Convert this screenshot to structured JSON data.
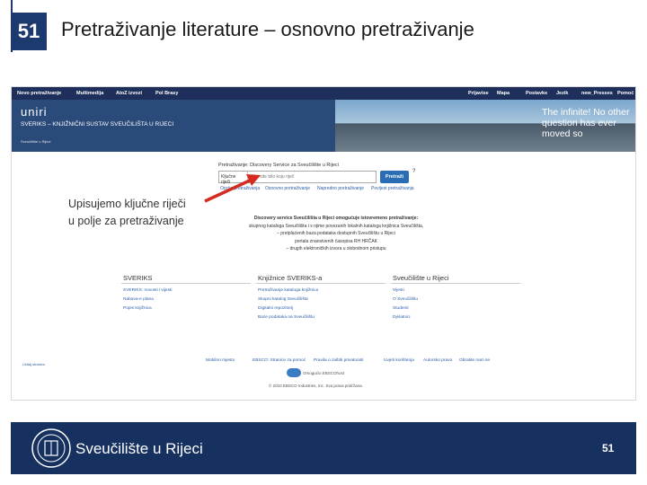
{
  "slide": {
    "number": "51",
    "title": "Pretraživanje literature – osnovno pretraživanje",
    "page_number": "51",
    "footer_title": "Sveučilište u Rijeci"
  },
  "topnav": {
    "items": [
      "Novo pretraživanje",
      "Multimedija",
      "AtoZ izvozi",
      "Pol Brasy"
    ],
    "right_items": [
      "Prijavise",
      "Mapa",
      "Postavke",
      "Jezik",
      "new_Presses",
      "Pomoć"
    ]
  },
  "banner": {
    "logo": "uniri",
    "title": "SVERIKS – KNJIŽNIČNI SUSTAV SVEUČILIŠTA U RIJECI",
    "small": "Sveučilište u Rijeci",
    "slogan": "The infinite! No other question has ever moved so"
  },
  "search": {
    "label": "Pretraživanje: Discovery Service za Sveučilište u Rijeci",
    "field_select": "Ključne riječi",
    "placeholder": "Unesite bilo koju riječ",
    "button": "Pretraži",
    "help": "?",
    "options": [
      "Opcije pretraživanja",
      "Osnovno pretraživanje",
      "Napredno pretraživanje",
      "Povijest pretraživanja"
    ]
  },
  "description": {
    "lines": [
      "Discovery service Sveučilišta u Rijeci omogućuje istovremeno pretraživanje:",
      "skupnog kataloga Sveučilišta i s njime povezanih lokalnih kataloga knjižnica Sveučilišta,",
      "– pretplaćenih baza podataka dostupnih Sveučilištu u Rijeci",
      "portala znanstvenih časopisa RH HRČAK",
      "– drugih elektroničkih izvora u slobodnom pristupu"
    ]
  },
  "columns": [
    {
      "title": "SVERIKS",
      "links": [
        "SVERIKS: novosti i vijesti",
        "Nabava-e plana",
        "Popis knjižnica"
      ]
    },
    {
      "title": "Knjižnice SVERIKS-a",
      "links": [
        "Pretraživanje kataloga knjižnica",
        "Skupni katalog Sveučilišta",
        "Digitalni repozitorij",
        "Baze podataka na Sveučilištu"
      ]
    },
    {
      "title": "Sveučilište u Rijeci",
      "links": [
        "Vijesti",
        "O Sveučilištu",
        "Studenti",
        "Djelatnici"
      ]
    }
  ],
  "footer": {
    "links": [
      "Mobilno mjesto",
      "EBSCO: Stranice za pomoć",
      "Pravila o zaštiti privatnosti",
      "Uvjeti korištenja",
      "Autorsko pravo",
      "Obratite nam se"
    ],
    "powered": "Omogućio EBSCOhost",
    "copyright": "© 2010 EBSCO Industries, Inc. Sva prava pridržana.",
    "left_small": "Učitaj stranicu"
  },
  "annotation": {
    "line1": "Upisujemo ključne riječi",
    "line2": "u polje za pretraživanje"
  },
  "colors": {
    "navy": "#16305f",
    "accent_blue": "#2b6db5",
    "arrow_red": "#d42b1e"
  }
}
